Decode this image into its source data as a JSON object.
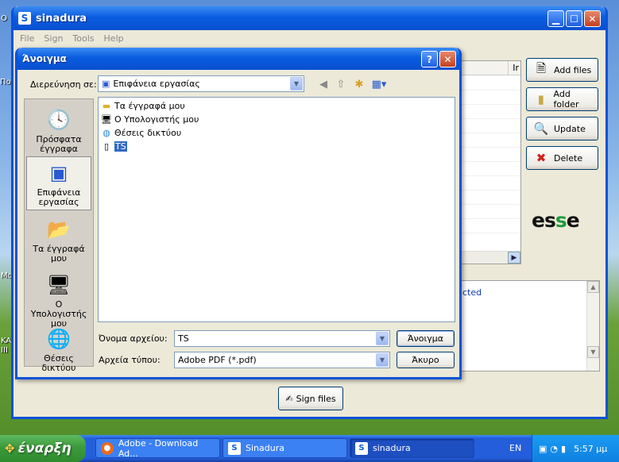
{
  "desktop": {
    "fragments": [
      "Ο",
      "Πο",
      "Mo",
      "KA",
      "ΙΙΙ"
    ]
  },
  "app": {
    "title": "sinadura",
    "menu": [
      "File",
      "Sign",
      "Tools",
      "Help"
    ],
    "table_header_fragment": "Ir",
    "buttons": {
      "add_files": "Add files",
      "add_folder": "Add folder",
      "update": "Update",
      "delete": "Delete"
    },
    "logo_text": {
      "part1": "es",
      "part2": "s",
      "part3": "e"
    },
    "log_text": "cted",
    "sign_button": "Sign files"
  },
  "dialog": {
    "title": "Άνοιγμα",
    "look_in_label": "Διερεύνηση σε:",
    "look_in_value": "Επιφάνεια εργασίας",
    "places": [
      "Πρόσφατα έγγραφα",
      "Επιφάνεια εργασίας",
      "Τα έγγραφά μου",
      "Ο Υπολογιστής μου",
      "Θέσεις δικτύου"
    ],
    "files": [
      "Τα έγγραφά μου",
      "Ο Υπολογιστής μου",
      "Θέσεις δικτύου",
      "TS"
    ],
    "filename_label": "Όνομα αρχείου:",
    "filename_value": "TS",
    "filetype_label": "Αρχεία τύπου:",
    "filetype_value": "Adobe PDF (*.pdf)",
    "open_button": "Άνοιγμα",
    "cancel_button": "Άκυρο"
  },
  "taskbar": {
    "start": "έναρξη",
    "items": [
      "Adobe - Download Ad...",
      "Sinadura",
      "sinadura"
    ],
    "language": "EN",
    "clock": "5:57 μμ"
  },
  "colors": {
    "xp_blue": "#0a5ce0",
    "selection": "#316ac5",
    "start_green": "#3c9a3c",
    "esse_green": "#1e9b3c"
  }
}
